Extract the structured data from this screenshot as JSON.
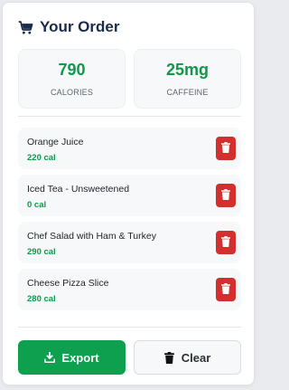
{
  "header": {
    "title": "Your Order",
    "icon": "cart-icon"
  },
  "stats": {
    "calories": {
      "value": "790",
      "label": "CALORIES"
    },
    "caffeine": {
      "value": "25mg",
      "label": "CAFFEINE"
    }
  },
  "items": [
    {
      "name": "Orange Juice",
      "calories": "220 cal"
    },
    {
      "name": "Iced Tea - Unsweetened",
      "calories": "0 cal"
    },
    {
      "name": "Chef Salad with Ham & Turkey",
      "calories": "290 cal"
    },
    {
      "name": "Cheese Pizza Slice",
      "calories": "280 cal"
    }
  ],
  "actions": {
    "export_label": "Export",
    "clear_label": "Clear"
  },
  "colors": {
    "accent_green": "#0ea04f",
    "delete_red": "#d32f2f",
    "title_navy": "#1b2b4b"
  }
}
